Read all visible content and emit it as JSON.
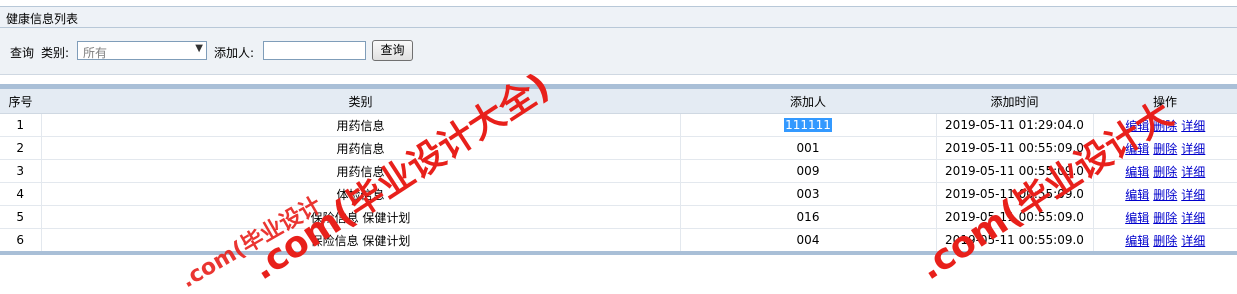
{
  "panel": {
    "title": "健康信息列表"
  },
  "search": {
    "query_label": "查询",
    "category_label": "类别:",
    "category_selected": "所有",
    "adder_label": "添加人:",
    "adder_value": "",
    "submit_label": "查询"
  },
  "table": {
    "headers": [
      "序号",
      "类别",
      "添加人",
      "添加时间",
      "操作"
    ],
    "rows": [
      {
        "no": "1",
        "category": "用药信息",
        "adder": "111111",
        "time": "2019-05-11 01:29:04.0"
      },
      {
        "no": "2",
        "category": "用药信息",
        "adder": "001",
        "time": "2019-05-11 00:55:09.0"
      },
      {
        "no": "3",
        "category": "用药信息",
        "adder": "009",
        "time": "2019-05-11 00:55:09.0"
      },
      {
        "no": "4",
        "category": "体检信息",
        "adder": "003",
        "time": "2019-05-11 00:55:09.0"
      },
      {
        "no": "5",
        "category": "保险信息 保健计划",
        "adder": "016",
        "time": "2019-05-11 00:55:09.0"
      },
      {
        "no": "6",
        "category": "保险信息 保健计划",
        "adder": "004",
        "time": "2019-05-11 00:55:09.0"
      }
    ],
    "actions": {
      "edit": "编辑",
      "delete": "删除",
      "detail": "详细"
    }
  },
  "watermark": {
    "text_1": ".com(毕业设计大全)",
    "text_2": ".com(毕业设计大",
    "text_3": ".com(毕业设计",
    "color": "#e8201b"
  }
}
